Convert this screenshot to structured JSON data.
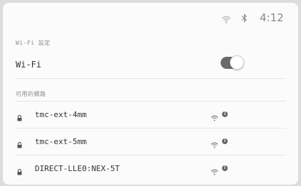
{
  "status_bar": {
    "time": "4:12",
    "icons": [
      "wifi-signal-icon",
      "bluetooth-icon"
    ]
  },
  "wifi_section": {
    "header": "Wi-Fi 設定",
    "toggle_label": "Wi-Fi",
    "toggle_on": true
  },
  "networks_section": {
    "header": "可用的網路",
    "networks": [
      {
        "name": "tmc-ext-4mm",
        "locked": true
      },
      {
        "name": "tmc-ext-5mm",
        "locked": true
      },
      {
        "name": "DIRECT-LLE0:NEX-5T",
        "locked": true
      }
    ]
  },
  "colors": {
    "background": "#fbfbfb",
    "toggle_track": "#6a6a6a",
    "text": "#333333",
    "muted": "#8a8a8a"
  }
}
